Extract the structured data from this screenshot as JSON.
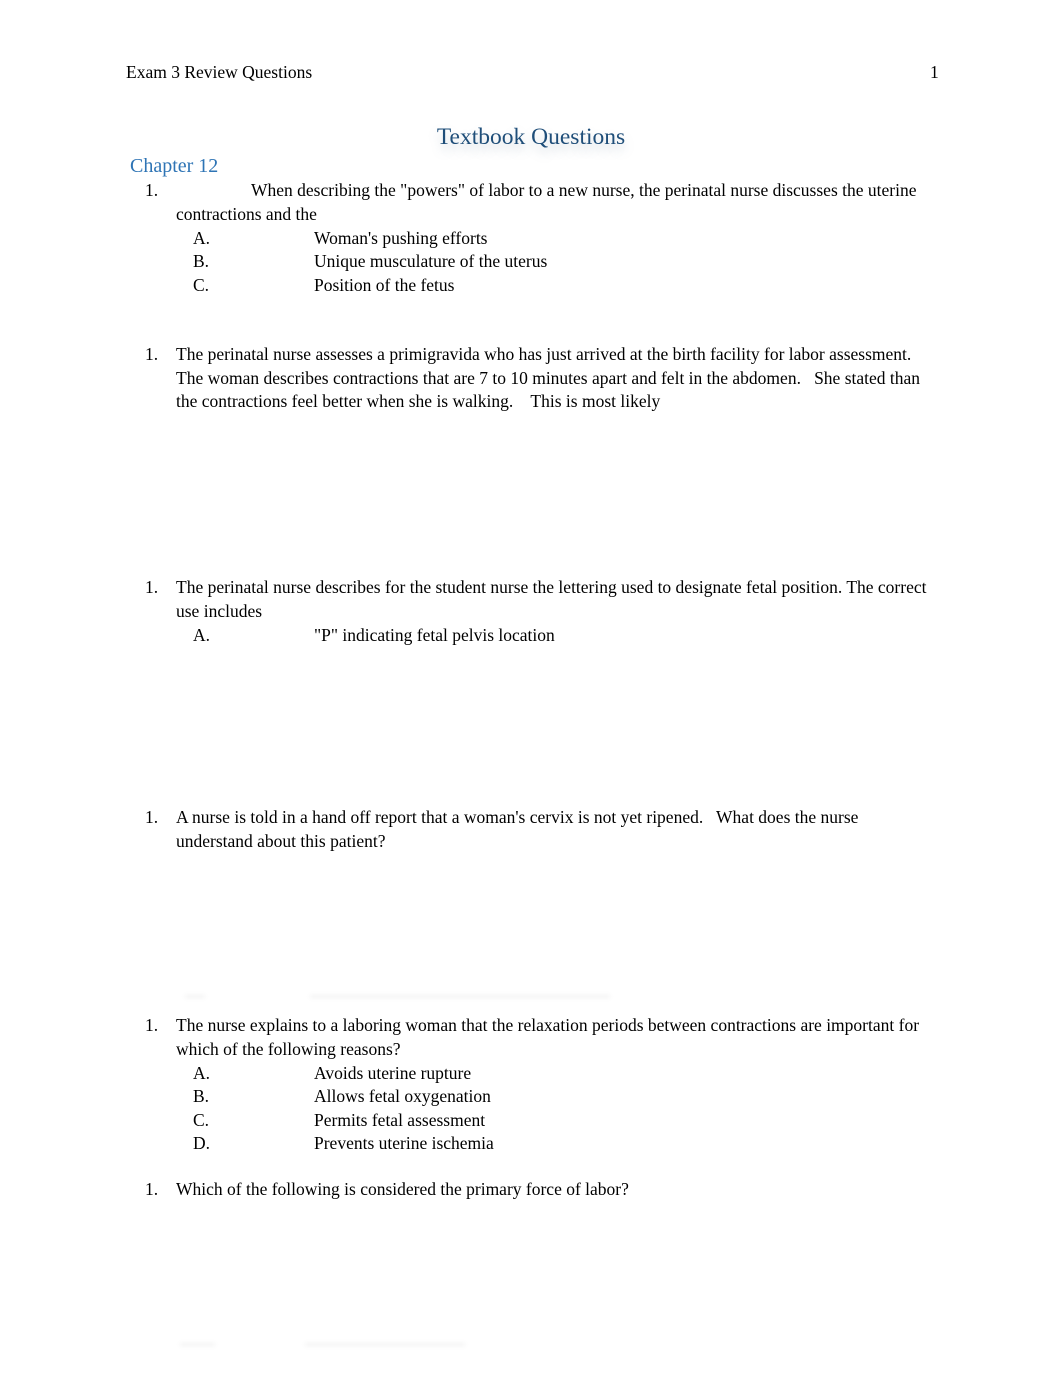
{
  "header": {
    "title": "Exam 3 Review Questions",
    "page_number": "1"
  },
  "document": {
    "title": "Textbook Questions",
    "chapter": "Chapter 12",
    "questions": [
      {
        "number": "1.",
        "text": "When describing the \"powers\" of labor to a new nurse, the perinatal nurse discusses the uterine contractions and the",
        "options": [
          {
            "letter": "A.",
            "text": "Woman's pushing efforts"
          },
          {
            "letter": "B.",
            "text": "Unique musculature of the uterus"
          },
          {
            "letter": "C.",
            "text": "Position of the fetus"
          }
        ]
      },
      {
        "number": "1.",
        "text": "The perinatal nurse assesses a primigravida who has just arrived at the birth facility for labor assessment.   The woman describes contractions that are 7 to 10 minutes apart and felt in the abdomen.   She stated than the contractions feel better when she is walking.    This is most likely"
      },
      {
        "number": "1.",
        "text": "The perinatal nurse describes for the student nurse the lettering used to designate fetal position. The correct use includes",
        "options": [
          {
            "letter": "A.",
            "text": "\"P\" indicating fetal pelvis location"
          }
        ]
      },
      {
        "number": "1.",
        "text": "A nurse is told in a hand off report that a woman's cervix is not yet ripened.   What does the nurse understand about this patient?"
      },
      {
        "number": "1.",
        "text": "The nurse explains to a laboring woman that the relaxation periods between contractions are important for which of the following reasons?",
        "options": [
          {
            "letter": "A.",
            "text": "Avoids uterine rupture"
          },
          {
            "letter": "B.",
            "text": "Allows fetal oxygenation"
          },
          {
            "letter": "C.",
            "text": "Permits fetal assessment"
          },
          {
            "letter": "D.",
            "text": "Prevents uterine ischemia"
          }
        ]
      },
      {
        "number": "1.",
        "text": "Which of the following is considered the primary force of labor?"
      }
    ]
  }
}
